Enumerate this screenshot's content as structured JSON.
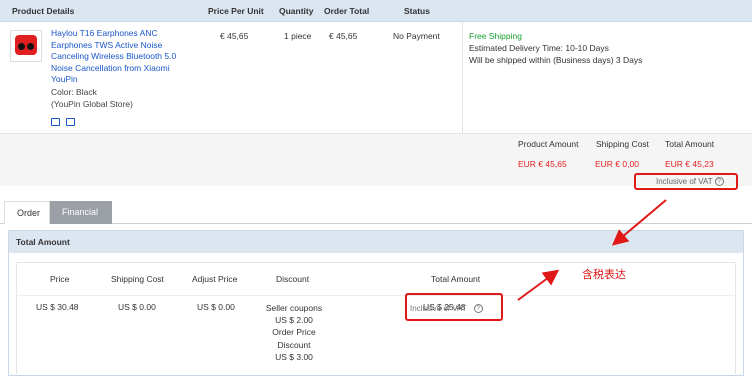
{
  "order": {
    "headers": {
      "product": "Product Details",
      "price": "Price Per Unit",
      "quantity": "Quantity",
      "total": "Order Total",
      "status": "Status"
    },
    "item": {
      "title_lines": [
        "Haylou T16 Earphones ANC",
        "Earphones TWS Active Noise",
        "Canceling Wireless Bluetooth 5.0",
        "Noise Cancellation from Xiaomi",
        "YouPin"
      ],
      "color": "Color: Black",
      "store": "(YouPin Global Store)",
      "price": "€ 45,65",
      "quantity": "1 piece",
      "order_total": "€ 45,65",
      "status": "No Payment",
      "shipping_label": "Free Shipping",
      "delivery": "Estimated Delivery Time: 10-10 Days",
      "ship_within": "Will be shipped within (Business days) 3 Days"
    },
    "totals": {
      "product_amount_label": "Product Amount",
      "shipping_cost_label": "Shipping Cost",
      "total_amount_label": "Total Amount",
      "product_amount": "EUR € 45,65",
      "shipping_cost": "EUR € 0,00",
      "total_amount": "EUR € 45,23",
      "vat_note": "Inclusive of VAT"
    }
  },
  "tabs": [
    {
      "label": "Order",
      "active": false
    },
    {
      "label": "Financial",
      "active": true
    }
  ],
  "financial": {
    "title": "Total Amount",
    "headers": {
      "price": "Price",
      "shipping": "Shipping Cost",
      "adjust": "Adjust Price",
      "discount": "Discount",
      "total": "Total Amount"
    },
    "values": {
      "price": "US $ 30.48",
      "shipping": "US $ 0.00",
      "adjust": "US $ 0.00",
      "discount_lines": [
        "Seller coupons",
        "US $ 2.00",
        "Order Price",
        "Discount",
        "US $ 3.00"
      ],
      "total": "US $ 25.48",
      "vat_note": "Inclusive of VAT"
    }
  },
  "annotation": {
    "note": "含税表达",
    "color": "#e01818"
  }
}
